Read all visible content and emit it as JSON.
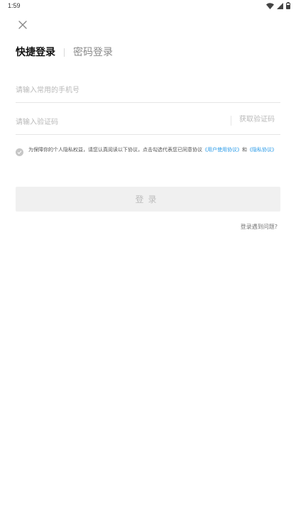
{
  "status_bar": {
    "time": "1:59",
    "icons": [
      "wifi-icon",
      "signal-icon",
      "battery-icon"
    ]
  },
  "tabs": [
    {
      "label": "快捷登录",
      "active": true
    },
    {
      "label": "密码登录",
      "active": false
    }
  ],
  "phone_field": {
    "value": "",
    "placeholder": "请输入常用的手机号"
  },
  "code_field": {
    "value": "",
    "placeholder": "请输入验证码"
  },
  "get_code_label": "获取验证码",
  "agreement": {
    "checked": false,
    "text": "为保障你的个人隐私权益，请您认真阅读以下协议，点击勾选代表您已同意协议",
    "user_agreement": "《用户使用协议》",
    "conjunction": "和",
    "privacy_policy": "《隐私协议》"
  },
  "login_button": {
    "label": "登录",
    "enabled": false
  },
  "help_link": "登录遇到问题?",
  "colors": {
    "link": "#2a9be8",
    "button_disabled_bg": "#f0f0f0",
    "button_disabled_text": "#bdbdbd"
  }
}
